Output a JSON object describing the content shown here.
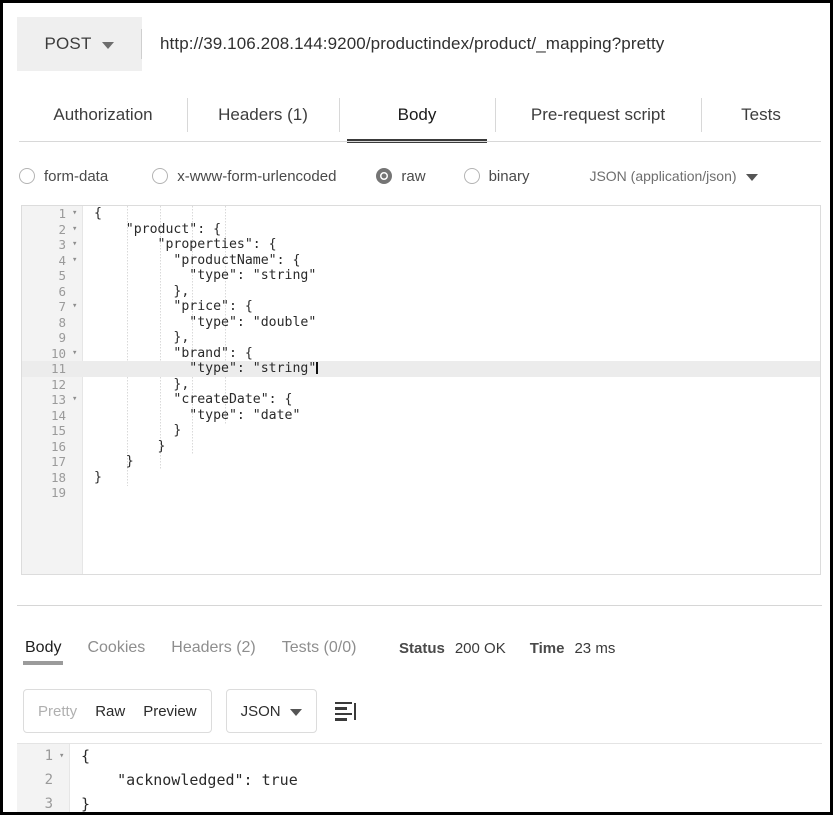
{
  "request": {
    "method": "POST",
    "method_caret_icon": "chevron-down-icon",
    "url": "http://39.106.208.144:9200/productindex/product/_mapping?pretty",
    "tabs": [
      {
        "id": "authorization",
        "label": "Authorization",
        "active": false
      },
      {
        "id": "headers",
        "label": "Headers (1)",
        "active": false
      },
      {
        "id": "body",
        "label": "Body",
        "active": true
      },
      {
        "id": "pre-request-script",
        "label": "Pre-request script",
        "active": false
      },
      {
        "id": "tests",
        "label": "Tests",
        "active": false
      }
    ],
    "body_types": [
      {
        "id": "form-data",
        "label": "form-data",
        "selected": false
      },
      {
        "id": "x-www-form-urlencoded",
        "label": "x-www-form-urlencoded",
        "selected": false
      },
      {
        "id": "raw",
        "label": "raw",
        "selected": true
      },
      {
        "id": "binary",
        "label": "binary",
        "selected": false
      }
    ],
    "content_type": {
      "label": "JSON (application/json)",
      "caret_icon": "chevron-down-icon"
    },
    "editor": {
      "highlighted_line": 11,
      "lines": [
        {
          "n": "1",
          "fold": "▾",
          "text": "{"
        },
        {
          "n": "2",
          "fold": "▾",
          "text": "    \"product\": {"
        },
        {
          "n": "3",
          "fold": "▾",
          "text": "        \"properties\": {"
        },
        {
          "n": "4",
          "fold": "▾",
          "text": "          \"productName\": {"
        },
        {
          "n": "5",
          "fold": "",
          "text": "            \"type\": \"string\""
        },
        {
          "n": "6",
          "fold": "",
          "text": "          },"
        },
        {
          "n": "7",
          "fold": "▾",
          "text": "          \"price\": {"
        },
        {
          "n": "8",
          "fold": "",
          "text": "            \"type\": \"double\""
        },
        {
          "n": "9",
          "fold": "",
          "text": "          },"
        },
        {
          "n": "10",
          "fold": "▾",
          "text": "          \"brand\": {"
        },
        {
          "n": "11",
          "fold": "",
          "text": "            \"type\": \"string\""
        },
        {
          "n": "12",
          "fold": "",
          "text": "          },"
        },
        {
          "n": "13",
          "fold": "▾",
          "text": "          \"createDate\": {"
        },
        {
          "n": "14",
          "fold": "",
          "text": "            \"type\": \"date\""
        },
        {
          "n": "15",
          "fold": "",
          "text": "          }"
        },
        {
          "n": "16",
          "fold": "",
          "text": "        }"
        },
        {
          "n": "17",
          "fold": "",
          "text": "    }"
        },
        {
          "n": "18",
          "fold": "",
          "text": "}"
        },
        {
          "n": "19",
          "fold": "",
          "text": ""
        }
      ]
    }
  },
  "response": {
    "tabs": [
      {
        "id": "body",
        "label": "Body",
        "active": true
      },
      {
        "id": "cookies",
        "label": "Cookies",
        "active": false
      },
      {
        "id": "headers",
        "label": "Headers (2)",
        "active": false
      },
      {
        "id": "tests",
        "label": "Tests (0/0)",
        "active": false
      }
    ],
    "status_key": "Status",
    "status_value": "200 OK",
    "time_key": "Time",
    "time_value": "23 ms",
    "view_modes": [
      {
        "id": "pretty",
        "label": "Pretty",
        "active": false
      },
      {
        "id": "raw",
        "label": "Raw",
        "active": true
      },
      {
        "id": "preview",
        "label": "Preview",
        "active": false
      }
    ],
    "format": {
      "label": "JSON",
      "caret_icon": "chevron-down-icon"
    },
    "wrap_icon": "text-wrap-icon",
    "editor": {
      "lines": [
        {
          "n": "1",
          "fold": "▾",
          "text": "{"
        },
        {
          "n": "2",
          "fold": "",
          "text": "    \"acknowledged\": true"
        },
        {
          "n": "3",
          "fold": "",
          "text": "}"
        }
      ]
    }
  }
}
